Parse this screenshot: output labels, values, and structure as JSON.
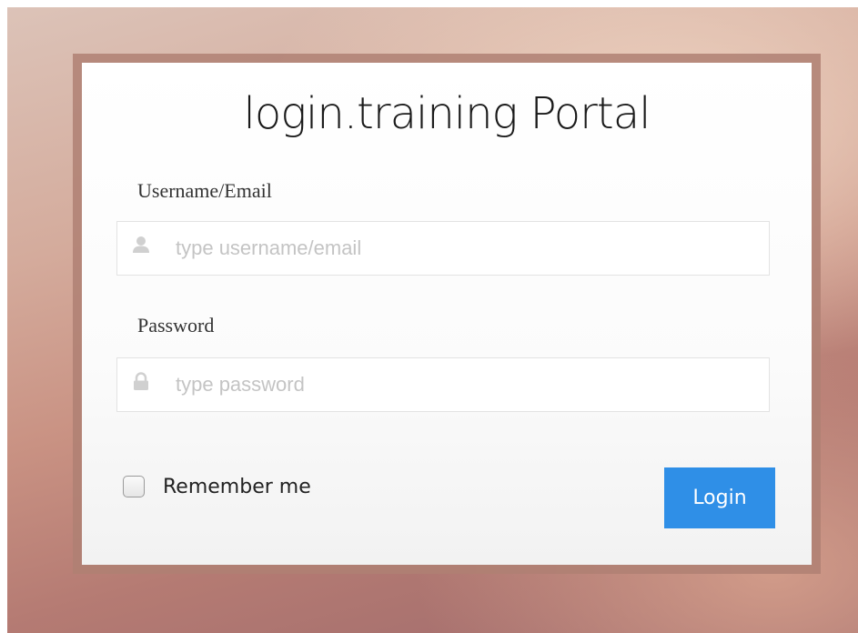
{
  "login": {
    "title": "login.training Portal",
    "username": {
      "label": "Username/Email",
      "placeholder": "type username/email",
      "value": "",
      "icon": "user-icon"
    },
    "password": {
      "label": "Password",
      "placeholder": "type password",
      "value": "",
      "icon": "lock-icon"
    },
    "remember": {
      "label": "Remember me",
      "checked": false
    },
    "submit_label": "Login"
  },
  "colors": {
    "button": "#2f8fe7",
    "button_text": "#ffffff",
    "frame": "#af8073",
    "placeholder": "#c4c4c4"
  }
}
